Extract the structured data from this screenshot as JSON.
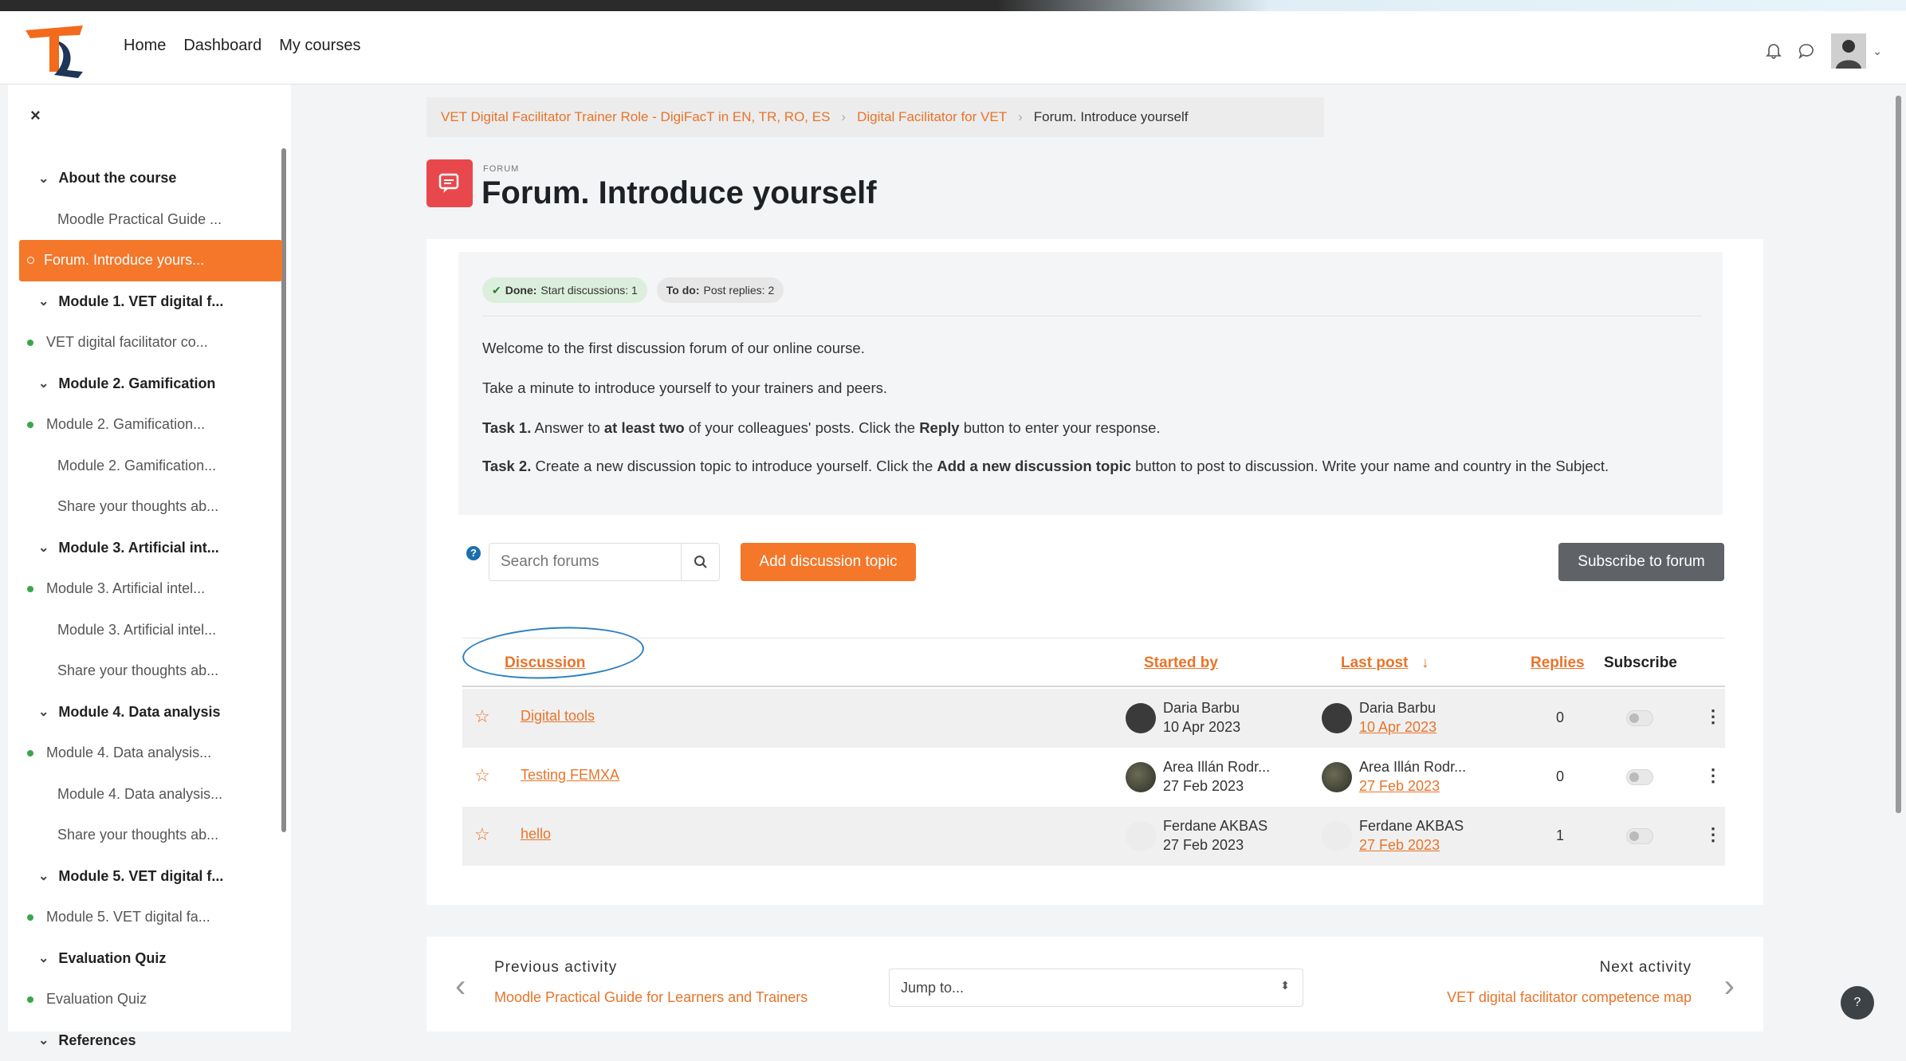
{
  "nav": {
    "links": [
      "Home",
      "Dashboard",
      "My courses"
    ]
  },
  "drawer": {
    "close": "×",
    "items": [
      {
        "kind": "section",
        "label": "About the course"
      },
      {
        "kind": "act",
        "label": "Moodle Practical Guide ..."
      },
      {
        "kind": "active",
        "label": "Forum. Introduce yours..."
      },
      {
        "kind": "section",
        "label": "Module 1. VET digital f..."
      },
      {
        "kind": "dot",
        "label": "VET digital facilitator co..."
      },
      {
        "kind": "section",
        "label": "Module 2. Gamification"
      },
      {
        "kind": "dot",
        "label": "Module 2. Gamification..."
      },
      {
        "kind": "act",
        "label": "Module 2. Gamification..."
      },
      {
        "kind": "act",
        "label": "Share your thoughts ab..."
      },
      {
        "kind": "section",
        "label": "Module 3. Artificial int..."
      },
      {
        "kind": "dot",
        "label": "Module 3. Artificial intel..."
      },
      {
        "kind": "act",
        "label": "Module 3. Artificial intel..."
      },
      {
        "kind": "act",
        "label": "Share your thoughts ab..."
      },
      {
        "kind": "section",
        "label": "Module 4. Data analysis"
      },
      {
        "kind": "dot",
        "label": "Module 4. Data analysis..."
      },
      {
        "kind": "act",
        "label": "Module 4. Data analysis..."
      },
      {
        "kind": "act",
        "label": "Share your thoughts ab..."
      },
      {
        "kind": "section",
        "label": "Module 5. VET digital f..."
      },
      {
        "kind": "dot",
        "label": "Module 5. VET digital fa..."
      },
      {
        "kind": "section",
        "label": "Evaluation Quiz"
      },
      {
        "kind": "dot",
        "label": "Evaluation Quiz"
      },
      {
        "kind": "section",
        "label": "References"
      }
    ]
  },
  "breadcrumb": {
    "course": "VET Digital Facilitator Trainer Role - DigiFacT in EN, TR, RO, ES",
    "section": "Digital Facilitator for VET",
    "current": "Forum. Introduce yourself"
  },
  "page": {
    "label": "FORUM",
    "title": "Forum. Introduce yourself"
  },
  "completion": {
    "done_label": "Done:",
    "done_text": "Start discussions: 1",
    "todo_label": "To do:",
    "todo_text": "Post replies: 2"
  },
  "intro": {
    "p1": "Welcome to the first discussion forum of our online course.",
    "p2": "Take a minute to introduce yourself to your trainers and peers.",
    "t1_label": "Task 1.",
    "t1_a": " Answer to ",
    "t1_b": "at least two",
    "t1_c": " of your colleagues' posts. Click the ",
    "t1_d": "Reply",
    "t1_e": " button to enter your response.",
    "t2_label": "Task 2.",
    "t2_a": " Create a new discussion topic to introduce yourself. Click the ",
    "t2_b": "Add a new discussion topic",
    "t2_c": " button to post to discussion. Write your name and country in the Subject."
  },
  "search": {
    "placeholder": "Search forums"
  },
  "buttons": {
    "add": "Add discussion topic",
    "subscribe": "Subscribe to forum"
  },
  "table": {
    "headers": {
      "discussion": "Discussion",
      "started_by": "Started by",
      "last_post": "Last post",
      "sort": "↓",
      "replies": "Replies",
      "subscribe": "Subscribe"
    },
    "rows": [
      {
        "title": "Digital tools",
        "starter": "Daria Barbu",
        "start_date": "10 Apr 2023",
        "last_name": "Daria Barbu",
        "last_date": "10 Apr 2023",
        "replies": "0"
      },
      {
        "title": "Testing FEMXA",
        "starter": "Area Illán Rodr...",
        "start_date": "27 Feb 2023",
        "last_name": "Area Illán Rodr...",
        "last_date": "27 Feb 2023",
        "replies": "0"
      },
      {
        "title": "hello",
        "starter": "Ferdane AKBAS",
        "start_date": "27 Feb 2023",
        "last_name": "Ferdane AKBAS",
        "last_date": "27 Feb 2023",
        "replies": "1"
      }
    ]
  },
  "activity_nav": {
    "prev_label": "Previous activity",
    "prev_link": "Moodle Practical Guide for Learners and Trainers",
    "jump": "Jump to...",
    "next_label": "Next activity",
    "next_link": "VET digital facilitator competence map"
  },
  "help": "?",
  "colors": {
    "accent": "#f4772a",
    "forum_icon": "#e8484c",
    "done_badge": "#dcefdc"
  }
}
